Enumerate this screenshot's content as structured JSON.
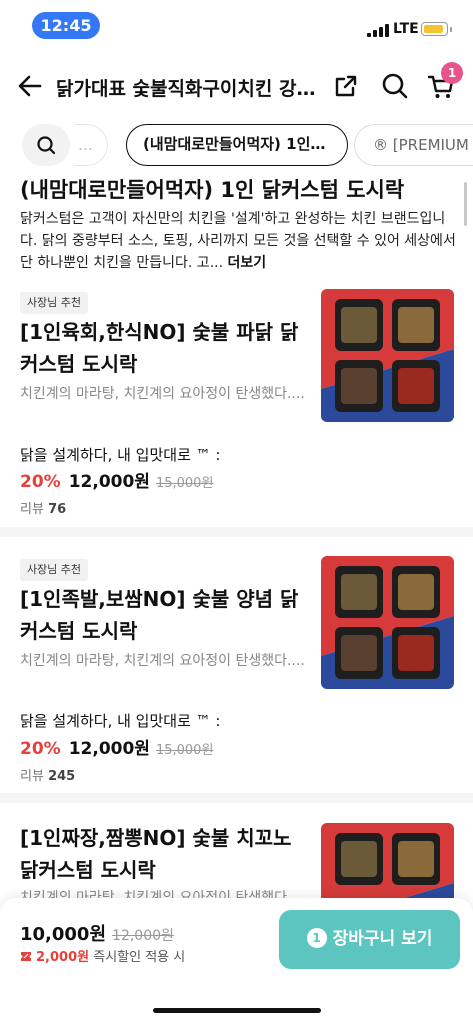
{
  "status_bar": {
    "time": "12:45",
    "network": "LTE"
  },
  "header": {
    "title": "닭가대표 숯불직화구이치킨 강…",
    "cart_count": "1"
  },
  "chips": {
    "fade_label": "…",
    "active_label": "(내맘대로만들어먹자) 1인…",
    "premium_label": "® [PREMIUM"
  },
  "category": {
    "heading": "(내맘대로만들어먹자) 1인 닭커스텀  도시락",
    "description": "닭커스텀은 고객이 자신만의 치킨을 '설계'하고 완성하는 치킨 브랜드입니다. 닭의 중량부터 소스, 토핑, 사리까지 모든 것을 선택할 수 있어 세상에서 단 하나뿐인 치킨을 만듭니다. 고... ",
    "more": "더보기"
  },
  "products": [
    {
      "badge": "사장님 추천",
      "name": "[1인육회,한식NO] 숯불 파닭 닭커스텀 도시락",
      "description": "치킨계의 마라탕, 치킨계의 요아정이 탄생했다....",
      "line": "닭을 설계하다, 내 입맛대로 ™ :",
      "discount": "20%",
      "price": "12,000원",
      "original_price": "15,000원",
      "reviews_label": "리뷰",
      "reviews_count": "76"
    },
    {
      "badge": "사장님 추천",
      "name": "[1인족발,보쌈NO] 숯불 양념 닭커스텀 도시락",
      "description": "치킨계의 마라탕, 치킨계의 요아정이 탄생했다....",
      "line": "닭을 설계하다, 내 입맛대로 ™ :",
      "discount": "20%",
      "price": "12,000원",
      "original_price": "15,000원",
      "reviews_label": "리뷰",
      "reviews_count": "245"
    },
    {
      "name": "[1인짜장,짬뽕NO] 숯불 치꼬노 닭커스텀 도시락",
      "description": "치킨계의 마라탕, 치킨계의 요아정이 탄생했다...."
    }
  ],
  "bottom_bar": {
    "total": "10,000원",
    "original_total": "12,000원",
    "instant_amount": "2,000원",
    "instant_label": "즉시할인 적용 시",
    "cart_button": "장바구니 보기",
    "cart_button_count": "1"
  },
  "colors": {
    "accent_teal": "#5cc5bf",
    "discount_red": "#e5423b",
    "badge_pink": "#e8548b",
    "time_blue": "#3478f6"
  }
}
